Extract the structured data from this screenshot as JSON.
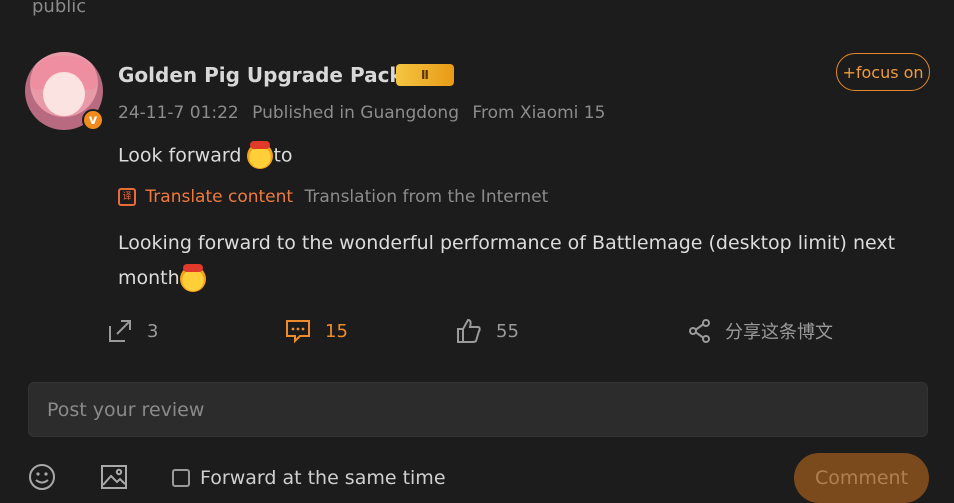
{
  "top_label": "public",
  "post": {
    "username": "Golden Pig Upgrade Pack",
    "vip_badge": "Ⅱ",
    "follow_label": "+focus on",
    "timestamp": "24-11-7 01:22",
    "location": "Published in Guangdong",
    "device": "From Xiaomi 15",
    "text_before": "Look forward ",
    "text_after": "to",
    "translate_label": "Translate content",
    "translate_source": "Translation from the Internet",
    "translated_text": "Looking forward to the wonderful performance of Battlemage (desktop limit) next month",
    "verified_mark": "v"
  },
  "actions": {
    "reposts": "3",
    "comments": "15",
    "likes": "55",
    "share_label": "分享这条博文"
  },
  "composer": {
    "placeholder": "Post your review",
    "forward_label": "Forward at the same time",
    "submit_label": "Comment"
  },
  "colors": {
    "accent": "#f08b2b",
    "background": "#1c1c1c"
  }
}
